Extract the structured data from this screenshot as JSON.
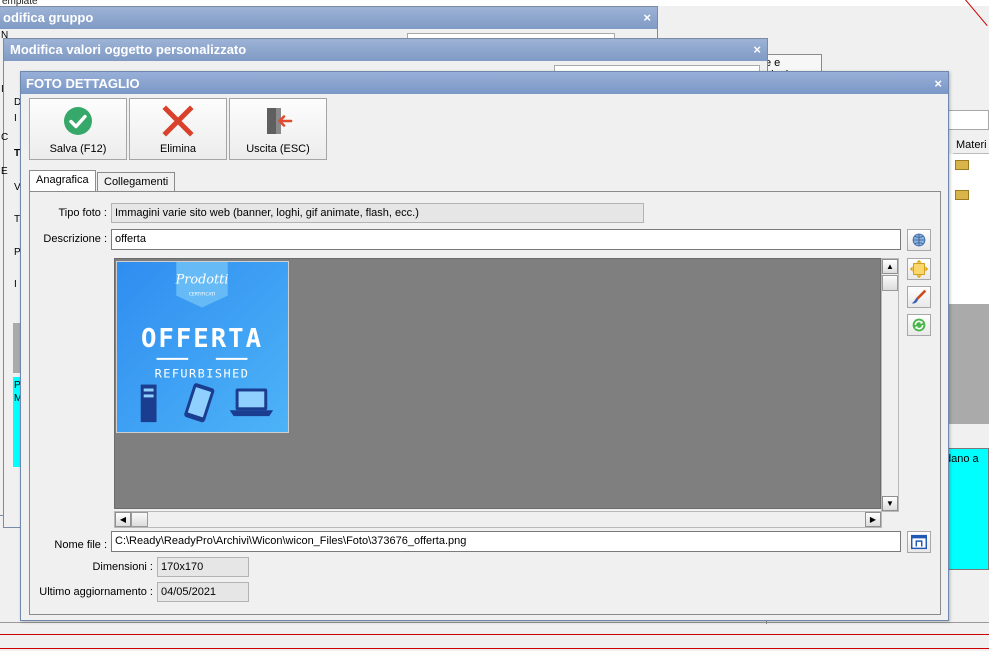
{
  "background": {
    "app_title": "emplate",
    "window1_title": "odifica gruppo",
    "window2_title": "Modifica valori oggetto personalizzato",
    "tab_plugins": "e e plugins",
    "column_header": "Materi",
    "cyan_text": "dano a",
    "left_letters": [
      "N",
      "I",
      "D",
      "I",
      "C",
      "E",
      "T",
      "V",
      "T",
      "P",
      "I",
      "P",
      "M"
    ]
  },
  "dialog": {
    "title": "FOTO DETTAGLIO",
    "close_glyph": "×",
    "toolbar": {
      "save_label": "Salva (F12)",
      "delete_label": "Elimina",
      "exit_label": "Uscita (ESC)"
    },
    "tabs": [
      {
        "label": "Anagrafica",
        "active": true
      },
      {
        "label": "Collegamenti",
        "active": false
      }
    ],
    "fields": {
      "tipo_foto_label": "Tipo foto :",
      "tipo_foto_value": "Immagini varie sito web (banner, loghi, gif animate, flash, ecc.)",
      "descrizione_label": "Descrizione :",
      "descrizione_value": "offerta",
      "nome_file_label": "Nome file :",
      "nome_file_value": "C:\\Ready\\ReadyPro\\Archivi\\Wicon\\wicon_Files\\Foto\\373676_offerta.png",
      "dimensioni_label": "Dimensioni :",
      "dimensioni_value": "170x170",
      "ultimo_label": "Ultimo aggiornamento :",
      "ultimo_value": "04/05/2021"
    },
    "photo": {
      "badge_text": "Prodotti",
      "badge_sub": "CERTIFICATI",
      "headline": "OFFERTA",
      "subline": "REFURBISHED"
    }
  },
  "colors": {
    "title_bar": "#7f9ac4",
    "cyan_panel": "#00ffff",
    "accent_red": "#cc0000",
    "image_area": "#7f7f7f"
  }
}
